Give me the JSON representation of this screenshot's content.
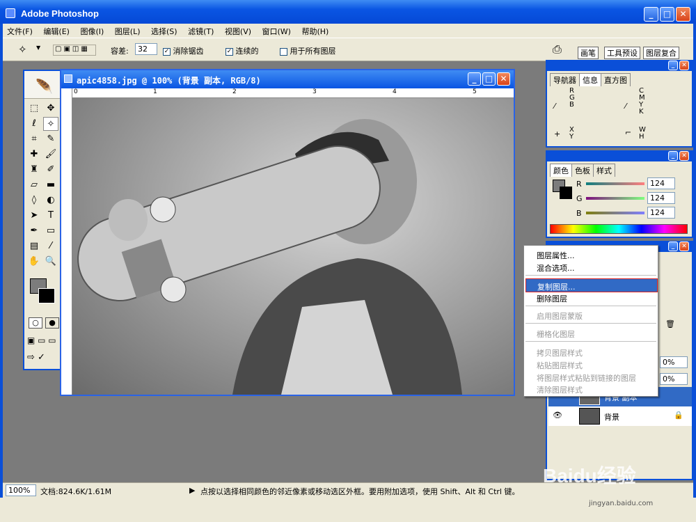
{
  "window": {
    "title": "Adobe Photoshop"
  },
  "menubar": [
    "文件(F)",
    "编辑(E)",
    "图像(I)",
    "图层(L)",
    "选择(S)",
    "滤镜(T)",
    "视图(V)",
    "窗口(W)",
    "帮助(H)"
  ],
  "options": {
    "tolerance_label": "容差:",
    "tolerance_value": "32",
    "antialias_label": "消除锯齿",
    "contiguous_label": "连续的",
    "all_layers_label": "用于所有图层",
    "right_tabs": [
      "画笔",
      "工具预设",
      "图层复合"
    ]
  },
  "document": {
    "title": "apic4858.jpg @ 100% (背景 副本, RGB/8)",
    "ruler_labels": [
      "0",
      "1",
      "2",
      "3",
      "4",
      "5"
    ]
  },
  "navigator_panel": {
    "tabs": [
      "导航器",
      "信息",
      "直方图"
    ],
    "rgb": [
      "R",
      "G",
      "B"
    ],
    "cmyk": [
      "C",
      "M",
      "Y",
      "K"
    ],
    "xy": [
      "X",
      "Y"
    ],
    "wh": [
      "W",
      "H"
    ]
  },
  "color_panel": {
    "tabs": [
      "颜色",
      "色板",
      "样式"
    ],
    "channels": [
      {
        "label": "R",
        "value": "124"
      },
      {
        "label": "G",
        "value": "124"
      },
      {
        "label": "B",
        "value": "124"
      }
    ]
  },
  "context_menu": {
    "items": [
      {
        "label": "图层属性...",
        "enabled": true
      },
      {
        "label": "混合选项...",
        "enabled": true
      },
      {
        "label": "复制图层...",
        "enabled": true,
        "highlighted": true
      },
      {
        "label": "删除图层",
        "enabled": true
      },
      {
        "label": "启用图层蒙版",
        "enabled": false
      },
      {
        "label": "栅格化图层",
        "enabled": false
      },
      {
        "label": "拷贝图层样式",
        "enabled": false
      },
      {
        "label": "粘贴图层样式",
        "enabled": false
      },
      {
        "label": "将图层样式粘贴到链接的图层",
        "enabled": false
      },
      {
        "label": "清除图层样式",
        "enabled": false
      }
    ]
  },
  "layers_panel": {
    "percent_1": "0%",
    "percent_2": "0%",
    "layers": [
      "背景 副本",
      "背景"
    ]
  },
  "statusbar": {
    "zoom": "100%",
    "doc": "文档:824.6K/1.61M",
    "hint": "点按以选择相同颜色的邻近像素或移动选区外框。要用附加选项，使用 Shift、Alt 和 Ctrl 键。"
  },
  "watermark": {
    "text": "Baidu经验",
    "url": "jingyan.baidu.com"
  }
}
